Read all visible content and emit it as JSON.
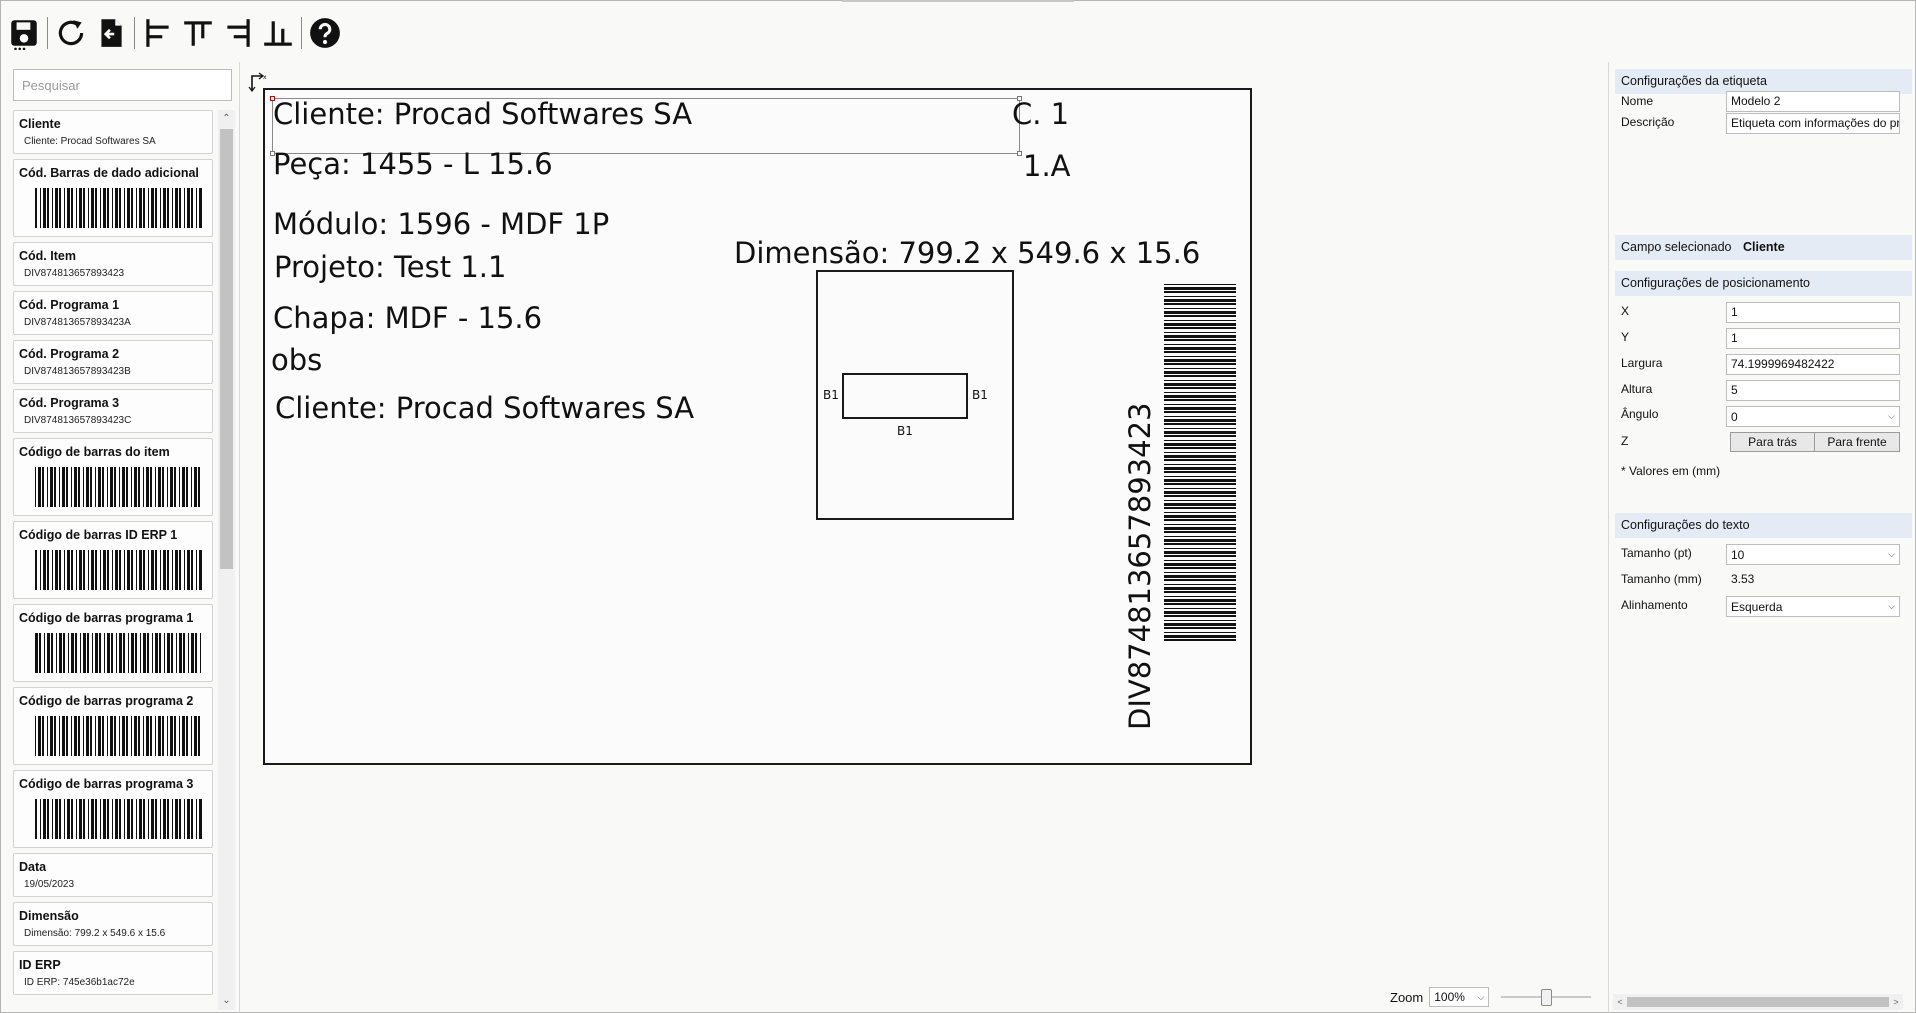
{
  "toolbar": {
    "buttons": [
      {
        "icon": "save-icon"
      },
      {
        "icon": "refresh-icon"
      },
      {
        "icon": "import-icon"
      },
      {
        "icon": "align-left-icon"
      },
      {
        "icon": "align-top-icon"
      },
      {
        "icon": "align-right-icon"
      },
      {
        "icon": "align-bottom-icon"
      },
      {
        "icon": "help-icon"
      }
    ]
  },
  "search": {
    "placeholder": "Pesquisar",
    "value": ""
  },
  "fields": [
    {
      "name": "Cliente",
      "value": "Cliente: Procad Softwares SA",
      "barcode": false
    },
    {
      "name": "Cód. Barras de dado adicional",
      "value": "",
      "barcode": true
    },
    {
      "name": "Cód. Item",
      "value": "DIV874813657893423",
      "barcode": false
    },
    {
      "name": "Cód. Programa 1",
      "value": "DIV874813657893423A",
      "barcode": false
    },
    {
      "name": "Cód. Programa 2",
      "value": "DIV874813657893423B",
      "barcode": false
    },
    {
      "name": "Cód. Programa 3",
      "value": "DIV874813657893423C",
      "barcode": false
    },
    {
      "name": "Código de barras do item",
      "value": "",
      "barcode": true
    },
    {
      "name": "Código de barras ID ERP 1",
      "value": "",
      "barcode": true
    },
    {
      "name": "Código de barras programa 1",
      "value": "",
      "barcode": true
    },
    {
      "name": "Código de barras programa 2",
      "value": "",
      "barcode": true
    },
    {
      "name": "Código de barras programa 3",
      "value": "",
      "barcode": true
    },
    {
      "name": "Data",
      "value": "19/05/2023",
      "barcode": false
    },
    {
      "name": "Dimensão",
      "value": "Dimensão: 799.2 x 549.6 x 15.6",
      "barcode": false
    },
    {
      "name": "ID ERP",
      "value": "ID ERP: 745e36b1ac72e",
      "barcode": false
    }
  ],
  "canvas": {
    "origin_mark": "x",
    "cliente": "Cliente: Procad Softwares SA",
    "c1": "C. 1",
    "peca": "Peça: 1455 - L 15.6",
    "one_a": "1.A",
    "modulo": "Módulo: 1596 - MDF 1P",
    "projeto": "Projeto: Test 1.1",
    "dimensao": "Dimensão: 799.2 x 549.6 x 15.6",
    "chapa": "Chapa: MDF - 15.6",
    "obs": "obs",
    "cliente2": "Cliente: Procad Softwares SA",
    "b1_left": "B1",
    "b1_right": "B1",
    "b1_bottom": "B1",
    "item_code": "DIV874813657893423"
  },
  "zoom": {
    "label": "Zoom",
    "value": "100%",
    "level": 0.5
  },
  "right": {
    "label_config": {
      "header": "Configurações da etiqueta",
      "name_label": "Nome",
      "name_value": "Modelo 2",
      "desc_label": "Descrição",
      "desc_value": "Etiqueta com informações do pr"
    },
    "selected": {
      "label": "Campo selecionado",
      "value": "Cliente"
    },
    "position": {
      "header": "Configurações de posicionamento",
      "x_label": "X",
      "x_value": "1",
      "y_label": "Y",
      "y_value": "1",
      "width_label": "Largura",
      "width_value": "74.1999969482422",
      "height_label": "Altura",
      "height_value": "5",
      "angle_label": "Ângulo",
      "angle_value": "0",
      "z_label": "Z",
      "back_button": "Para trás",
      "front_button": "Para frente",
      "note": "* Valores em (mm)"
    },
    "text": {
      "header": "Configurações do texto",
      "size_pt_label": "Tamanho (pt)",
      "size_pt_value": "10",
      "size_mm_label": "Tamanho (mm)",
      "size_mm_value": "3.53",
      "align_label": "Alinhamento",
      "align_value": "Esquerda"
    }
  },
  "colors": {
    "section_header": "#e4ebf4",
    "border": "#1a1a1a",
    "background": "#f9f9f7"
  }
}
